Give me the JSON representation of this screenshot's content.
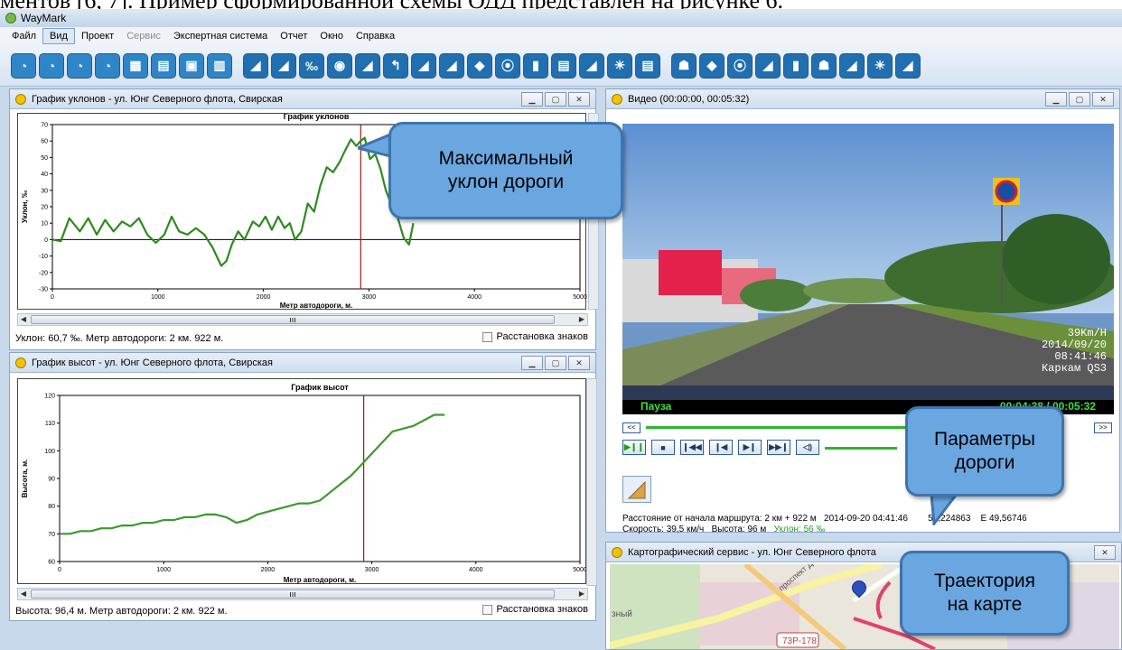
{
  "document_text": "ментов [6, 7]. Пример сформированной схемы ОДД представлен на рисунке 6.",
  "app": {
    "title": "WayMark"
  },
  "menu": [
    "Файл",
    "Вид",
    "Проект",
    "Сервис",
    "Экспертная система",
    "Отчет",
    "Окно",
    "Справка"
  ],
  "slope_panel": {
    "title": "График уклонов - ул. Юнг Северного флота, Свирская",
    "status": "Уклон: 60,7 ‰. Метр автодороги: 2 км. 922 м.",
    "checkbox_label": "Расстановка знаков"
  },
  "height_panel": {
    "title": "График высот - ул. Юнг Северного флота, Свирская",
    "status": "Высота: 96,4 м. Метр автодороги: 2 км. 922 м.",
    "checkbox_label": "Расстановка знаков"
  },
  "video_panel": {
    "title": "Видео (00:00:00, 00:05:32)",
    "overlay_lines": [
      "39Km/H",
      "2014/09/20",
      "08:41:46",
      "Каркам QS3"
    ],
    "state": "Пауза",
    "time": "00:04:38 / 00:05:32",
    "info_line1_a": "Расстояние от начала маршрута: 2 км + 922 м",
    "info_line1_b": "2014-09-20 04:41:46",
    "info_line1_c": "54,224863",
    "info_line1_d": "E 49,56746",
    "info_line2_a": "Скорость: 39,5 км/ч",
    "info_line2_b": "Высота: 96 м",
    "info_line2_c": "Уклон: 56 ‰"
  },
  "map_panel": {
    "title": "Картографический сервис - ул. Юнг Северного флота",
    "road_label": "73Р-178",
    "street_label": "проспект Димитр",
    "side_label": "зный"
  },
  "callouts": {
    "slope": [
      "Максимальный",
      "уклон дороги"
    ],
    "params": [
      "Параметры",
      "дороги"
    ],
    "trajectory": [
      "Траектория",
      "на карте"
    ]
  },
  "chart_data": [
    {
      "type": "line",
      "title": "График уклонов",
      "xlabel": "Метр автодороги, м.",
      "ylabel": "Уклон, ‰",
      "xlim": [
        0,
        5000
      ],
      "ylim": [
        -30,
        70
      ],
      "x_ticks": [
        0,
        1000,
        2000,
        3000,
        4000,
        5000
      ],
      "y_ticks": [
        70,
        60,
        50,
        40,
        30,
        20,
        10,
        0,
        -10,
        -20,
        -30
      ],
      "marker_x": 2922,
      "series": [
        {
          "color": "#2f8a1f",
          "x": [
            0,
            80,
            160,
            260,
            340,
            420,
            500,
            580,
            660,
            740,
            820,
            900,
            980,
            1060,
            1130,
            1200,
            1280,
            1360,
            1440,
            1520,
            1600,
            1650,
            1700,
            1760,
            1820,
            1900,
            1960,
            2020,
            2080,
            2140,
            2200,
            2250,
            2300,
            2360,
            2420,
            2480,
            2540,
            2600,
            2660,
            2720,
            2780,
            2830,
            2880,
            2920,
            2960,
            3010,
            3060,
            3110,
            3160,
            3220,
            3270,
            3330,
            3380,
            3420
          ],
          "y": [
            0,
            -1,
            13,
            5,
            13,
            3,
            12,
            5,
            11,
            8,
            13,
            3,
            -2,
            3,
            14,
            5,
            3,
            7,
            3,
            -5,
            -16,
            -13,
            -3,
            5,
            0,
            11,
            8,
            14,
            6,
            14,
            7,
            10,
            0,
            5,
            22,
            17,
            33,
            44,
            41,
            47,
            55,
            61,
            57,
            60,
            62,
            49,
            52,
            43,
            30,
            20,
            14,
            1,
            -3,
            10
          ]
        }
      ]
    },
    {
      "type": "line",
      "title": "График высот",
      "xlabel": "Метр автодороги, м.",
      "ylabel": "Высота, м.",
      "xlim": [
        0,
        5000
      ],
      "ylim": [
        60,
        120
      ],
      "x_ticks": [
        0,
        1000,
        2000,
        3000,
        4000,
        5000
      ],
      "y_ticks": [
        120,
        110,
        100,
        90,
        80,
        70,
        60
      ],
      "marker_x": 2922,
      "series": [
        {
          "color": "#3c9a2c",
          "x": [
            0,
            100,
            200,
            300,
            400,
            500,
            600,
            700,
            800,
            900,
            1000,
            1100,
            1200,
            1300,
            1400,
            1500,
            1600,
            1700,
            1800,
            1900,
            2000,
            2100,
            2200,
            2300,
            2400,
            2500,
            2600,
            2700,
            2800,
            2900,
            3000,
            3100,
            3200,
            3300,
            3400,
            3500,
            3600,
            3700
          ],
          "y": [
            70,
            70,
            71,
            71,
            72,
            72,
            73,
            73,
            74,
            74,
            75,
            75,
            76,
            76,
            77,
            77,
            76,
            74,
            75,
            77,
            78,
            79,
            80,
            81,
            81,
            82,
            85,
            88,
            91,
            95,
            99,
            103,
            107,
            108,
            109,
            111,
            113,
            113
          ]
        }
      ]
    }
  ]
}
